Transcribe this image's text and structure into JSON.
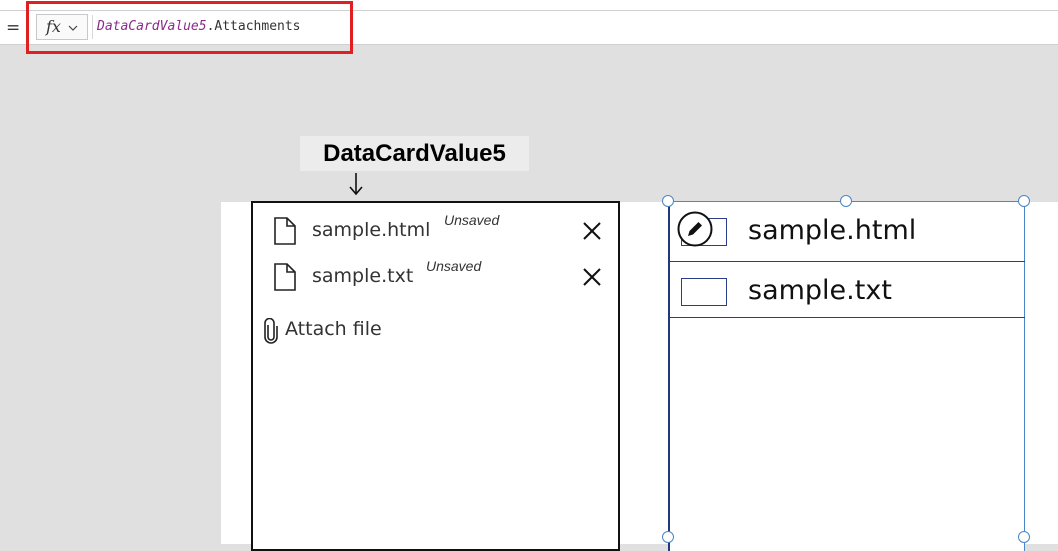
{
  "formula_bar": {
    "equals": "=",
    "fx_label": "fx",
    "formula_ref": "DataCardValue5",
    "formula_rest": ".Attachments"
  },
  "callout": {
    "label": "DataCardValue5",
    "arrow": "↓"
  },
  "attachments": {
    "items": [
      {
        "name": "sample.html",
        "status": "Unsaved"
      },
      {
        "name": "sample.txt",
        "status": "Unsaved"
      }
    ],
    "attach_label": "Attach file"
  },
  "gallery": {
    "items": [
      {
        "text": "sample.html"
      },
      {
        "text": "sample.txt"
      }
    ]
  },
  "colors": {
    "highlight": "#e02020",
    "formula_ref": "#8b2a8b",
    "gallery_border": "#2b3f86",
    "selection_handle": "#4a86c8"
  },
  "icons": [
    "fx-icon",
    "chevron-down-icon",
    "file-icon",
    "close-icon",
    "paperclip-icon",
    "edit-icon",
    "down-arrow-icon"
  ]
}
